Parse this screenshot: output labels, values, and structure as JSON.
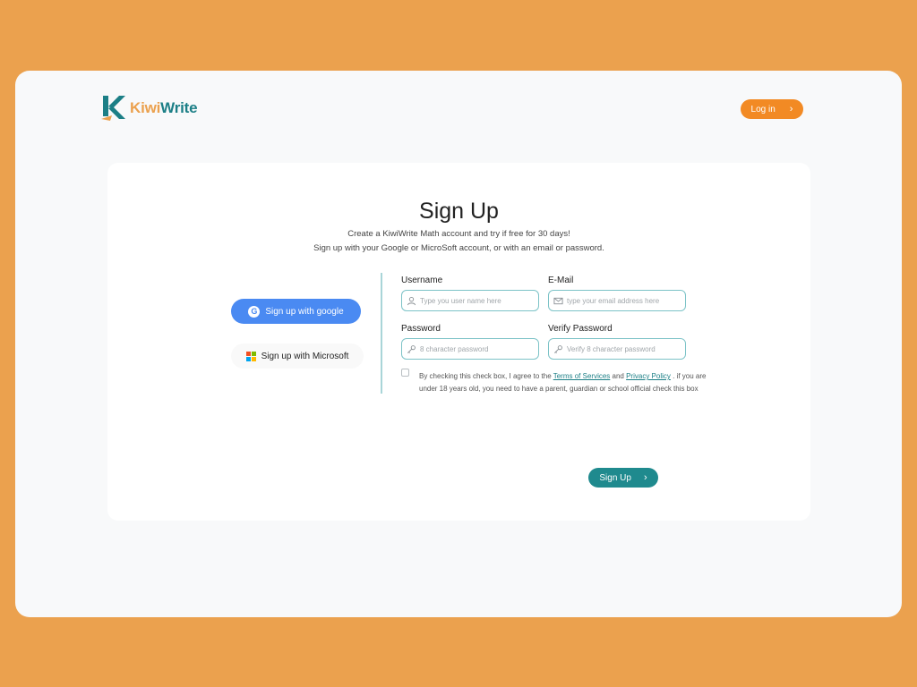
{
  "brand": {
    "name_part1": "Kiwi",
    "name_part2": "Write"
  },
  "header": {
    "login_label": "Log in",
    "login_chevron": "›"
  },
  "page": {
    "title": "Sign Up",
    "subtitle_line1": "Create a KiwiWrite Math account and try if free for 30 days!",
    "subtitle_line2": "Sign up with your Google or MicroSoft account, or with an email or password."
  },
  "social": {
    "google_label": "Sign up with google",
    "google_glyph": "G",
    "microsoft_label": "Sign up with Microsoft"
  },
  "form": {
    "username": {
      "label": "Username",
      "placeholder": "Type you user name here",
      "value": "",
      "icon": "user-icon"
    },
    "email": {
      "label": "E-Mail",
      "placeholder": "type your email address here",
      "value": "",
      "icon": "mail-icon"
    },
    "password": {
      "label": "Password",
      "placeholder": "8 character password",
      "value": "",
      "icon": "key-icon"
    },
    "verify_password": {
      "label": "Verify Password",
      "placeholder": "Verify 8 character password",
      "value": "",
      "icon": "key-icon"
    },
    "terms": {
      "checked": false,
      "text_before": "By checking this check box, I agree to the ",
      "terms_link": "Terms of Services",
      "and": " and ",
      "privacy_link": "Privacy Policy",
      "text_after": " . if you are under 18 years old, you need to have a parent, guardian or school official check this box"
    },
    "submit_label": "Sign Up",
    "submit_chevron": "›"
  },
  "colors": {
    "background": "#EBA14E",
    "accent_orange": "#F28A24",
    "teal": "#1F8A8E",
    "google_blue": "#4A8AF2",
    "field_border": "#7CC3C7",
    "ms_red": "#F25022",
    "ms_green": "#7FBA00",
    "ms_blue": "#00A4EF",
    "ms_yellow": "#FFB900"
  }
}
